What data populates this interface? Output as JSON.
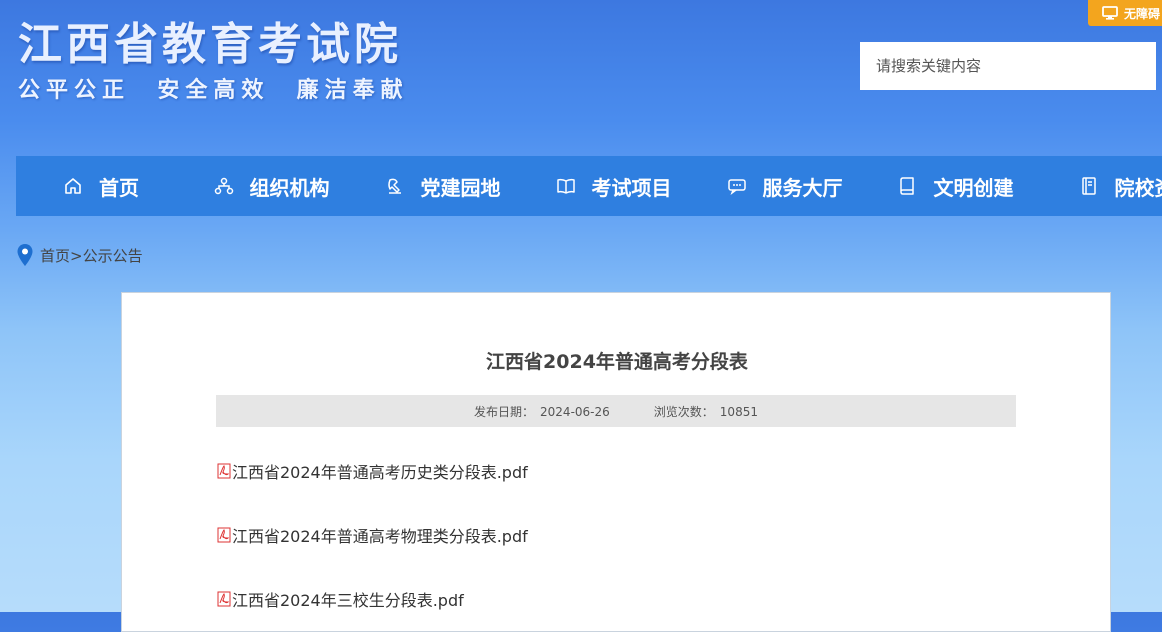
{
  "header": {
    "title": "江西省教育考试院",
    "slogan": "公平公正  安全高效  廉洁奉献",
    "accessibility_label": "无障碍",
    "search_placeholder": "请搜索关键内容"
  },
  "nav": {
    "items": [
      {
        "label": "首页",
        "icon": "home-icon"
      },
      {
        "label": "组织机构",
        "icon": "org-chart-icon"
      },
      {
        "label": "党建园地",
        "icon": "party-icon"
      },
      {
        "label": "考试项目",
        "icon": "open-book-icon"
      },
      {
        "label": "服务大厅",
        "icon": "chat-icon"
      },
      {
        "label": "文明创建",
        "icon": "book-icon"
      },
      {
        "label": "院校资",
        "icon": "document-icon"
      }
    ]
  },
  "breadcrumb": {
    "home": "首页",
    "separator": ">",
    "current": "公示公告"
  },
  "article": {
    "title": "江西省2024年普通高考分段表",
    "date_label": "发布日期：",
    "date": "2024-06-26",
    "views_label": "浏览次数：",
    "views": "10851",
    "attachments": [
      {
        "name": "江西省2024年普通高考历史类分段表.pdf",
        "icon": "pdf-icon"
      },
      {
        "name": "江西省2024年普通高考物理类分段表.pdf",
        "icon": "pdf-icon"
      },
      {
        "name": "江西省2024年三校生分段表.pdf",
        "icon": "pdf-icon"
      }
    ]
  },
  "colors": {
    "nav_bar": "#2f7fe0",
    "accent_orange": "#f3a51e",
    "meta_bar": "#e6e6e6"
  }
}
